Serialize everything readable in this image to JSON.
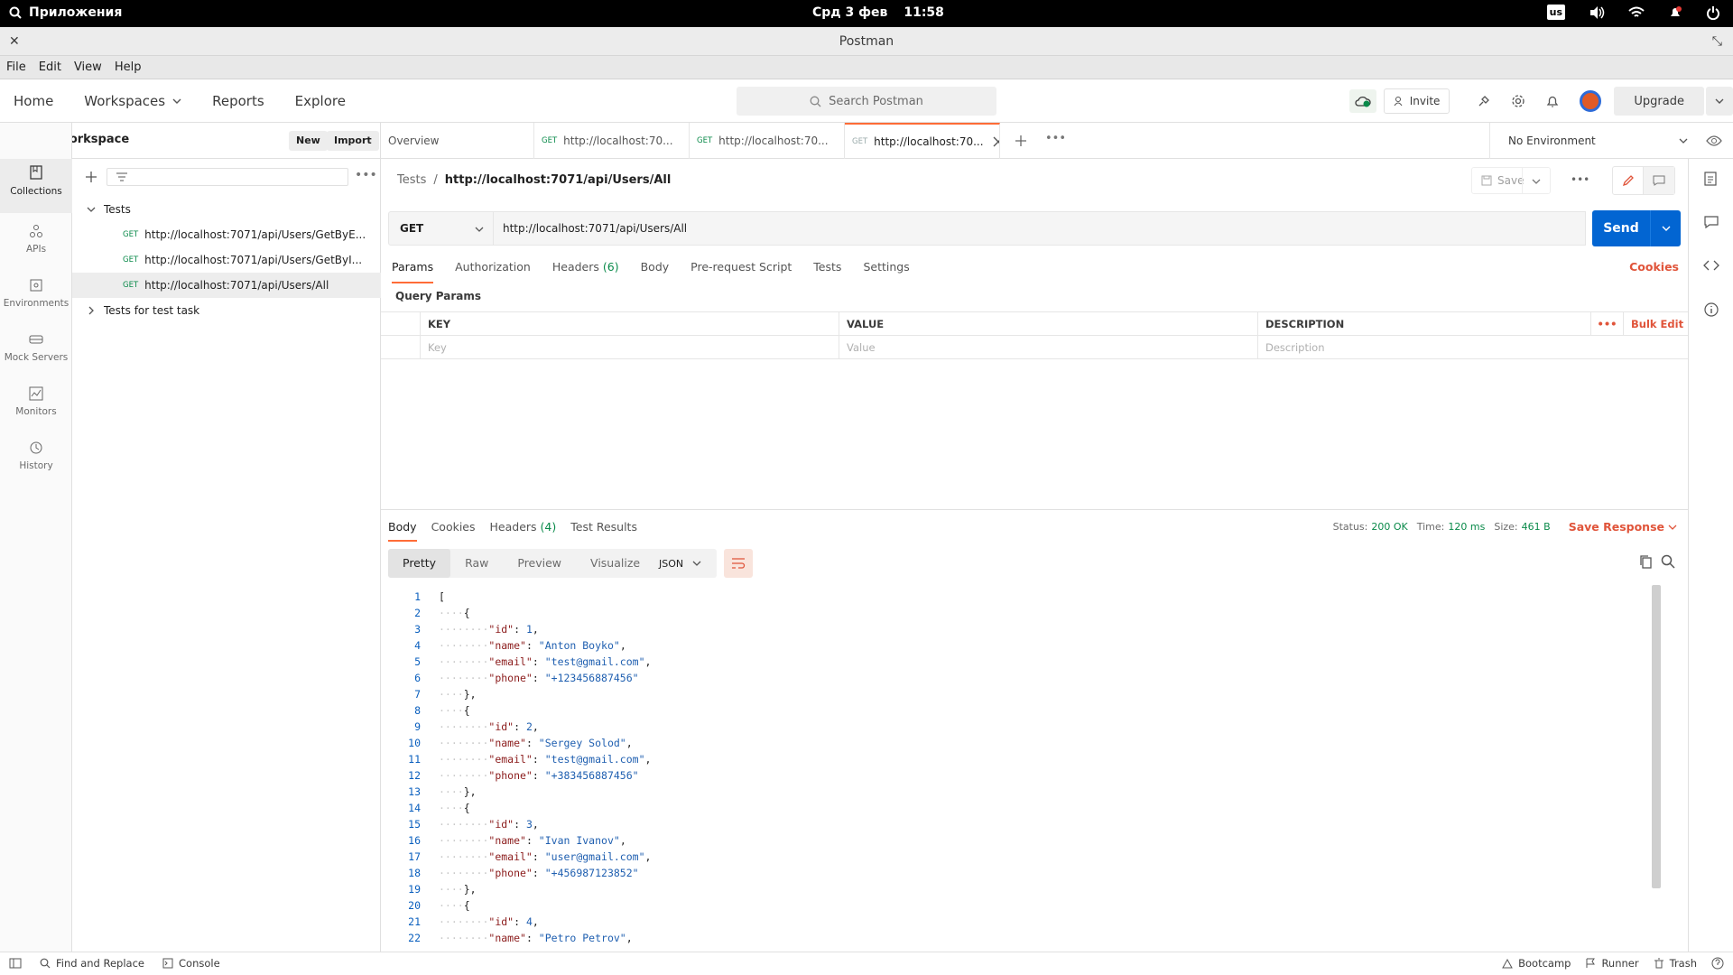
{
  "system": {
    "apps_label": "Приложения",
    "date": "Срд 3 фев",
    "time": "11:58",
    "lang": "us"
  },
  "window": {
    "title": "Postman"
  },
  "menu": [
    "File",
    "Edit",
    "View",
    "Help"
  ],
  "header": {
    "nav": {
      "home": "Home",
      "workspaces": "Workspaces",
      "reports": "Reports",
      "explore": "Explore"
    },
    "search_placeholder": "Search Postman",
    "invite": "Invite",
    "upgrade": "Upgrade"
  },
  "workspace": {
    "name": "My Workspace",
    "new": "New",
    "import": "Import"
  },
  "rail": [
    "Collections",
    "APIs",
    "Environments",
    "Mock Servers",
    "Monitors",
    "History"
  ],
  "collections": {
    "folder1": "Tests",
    "items": [
      {
        "method": "GET",
        "url": "http://localhost:7071/api/Users/GetByE..."
      },
      {
        "method": "GET",
        "url": "http://localhost:7071/api/Users/GetByI..."
      },
      {
        "method": "GET",
        "url": "http://localhost:7071/api/Users/All"
      }
    ],
    "folder2": "Tests for test task"
  },
  "tabs": {
    "overview": "Overview",
    "items": [
      {
        "method": "GET",
        "url": "http://localhost:70..."
      },
      {
        "method": "GET",
        "url": "http://localhost:70..."
      },
      {
        "method": "GET",
        "url": "http://localhost:70..."
      }
    ],
    "environment": "No Environment"
  },
  "request": {
    "crumb_parent": "Tests",
    "crumb_sep": "/",
    "crumb_name": "http://localhost:7071/api/Users/All",
    "save": "Save",
    "method": "GET",
    "url": "http://localhost:7071/api/Users/All",
    "send": "Send",
    "tabs": {
      "params": "Params",
      "authorization": "Authorization",
      "headers": "Headers",
      "headers_count": "(6)",
      "body": "Body",
      "prerequest": "Pre-request Script",
      "tests": "Tests",
      "settings": "Settings"
    },
    "cookies": "Cookies",
    "query_params": "Query Params",
    "columns": {
      "key": "KEY",
      "value": "VALUE",
      "description": "DESCRIPTION"
    },
    "bulk_edit": "Bulk Edit",
    "placeholders": {
      "key": "Key",
      "value": "Value",
      "description": "Description"
    }
  },
  "response": {
    "tabs": {
      "body": "Body",
      "cookies": "Cookies",
      "headers": "Headers",
      "headers_count": "(4)",
      "tests": "Test Results"
    },
    "status_label": "Status:",
    "status": "200 OK",
    "time_label": "Time:",
    "time": "120 ms",
    "size_label": "Size:",
    "size": "461 B",
    "save_response": "Save Response",
    "views": {
      "pretty": "Pretty",
      "raw": "Raw",
      "preview": "Preview",
      "visualize": "Visualize"
    },
    "format": "JSON",
    "lines": [
      {
        "n": "1",
        "t": "["
      },
      {
        "n": "2",
        "t": "····{"
      },
      {
        "n": "3",
        "t": "········\"id\": 1,"
      },
      {
        "n": "4",
        "t": "········\"name\": \"Anton Boyko\","
      },
      {
        "n": "5",
        "t": "········\"email\": \"test@gmail.com\","
      },
      {
        "n": "6",
        "t": "········\"phone\": \"+123456887456\""
      },
      {
        "n": "7",
        "t": "····},"
      },
      {
        "n": "8",
        "t": "····{"
      },
      {
        "n": "9",
        "t": "········\"id\": 2,"
      },
      {
        "n": "10",
        "t": "········\"name\": \"Sergey Solod\","
      },
      {
        "n": "11",
        "t": "········\"email\": \"test@gmail.com\","
      },
      {
        "n": "12",
        "t": "········\"phone\": \"+383456887456\""
      },
      {
        "n": "13",
        "t": "····},"
      },
      {
        "n": "14",
        "t": "····{"
      },
      {
        "n": "15",
        "t": "········\"id\": 3,"
      },
      {
        "n": "16",
        "t": "········\"name\": \"Ivan Ivanov\","
      },
      {
        "n": "17",
        "t": "········\"email\": \"user@gmail.com\","
      },
      {
        "n": "18",
        "t": "········\"phone\": \"+456987123852\""
      },
      {
        "n": "19",
        "t": "····},"
      },
      {
        "n": "20",
        "t": "····{"
      },
      {
        "n": "21",
        "t": "········\"id\": 4,"
      },
      {
        "n": "22",
        "t": "········\"name\": \"Petro Petrov\","
      }
    ]
  },
  "statusbar": {
    "find": "Find and Replace",
    "console": "Console",
    "bootcamp": "Bootcamp",
    "runner": "Runner",
    "trash": "Trash"
  },
  "colors": {
    "accent": "#ff6c37",
    "send": "#0265d2",
    "ok": "#0a8a4a",
    "danger": "#e0543a"
  }
}
